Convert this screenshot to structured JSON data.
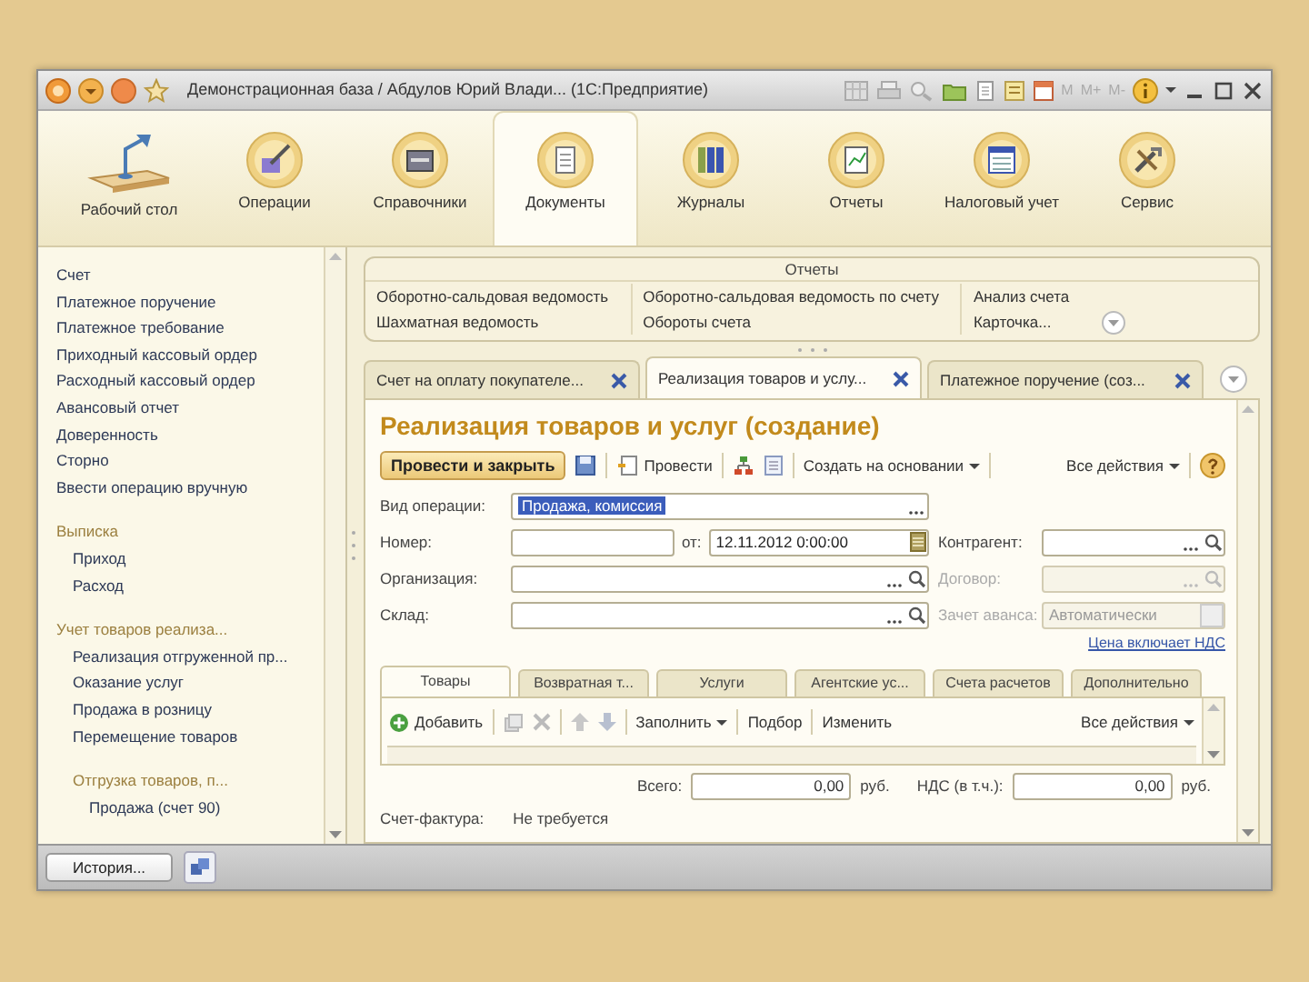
{
  "window": {
    "title": "Демонстрационная база / Абдулов Юрий Влади... (1С:Предприятие)",
    "memory_buttons": [
      "M",
      "M+",
      "M-"
    ]
  },
  "sections": [
    {
      "label": "Рабочий стол",
      "selected": false
    },
    {
      "label": "Операции",
      "selected": false
    },
    {
      "label": "Справочники",
      "selected": false
    },
    {
      "label": "Документы",
      "selected": true
    },
    {
      "label": "Журналы",
      "selected": false
    },
    {
      "label": "Отчеты",
      "selected": false
    },
    {
      "label": "Налоговый учет",
      "selected": false
    },
    {
      "label": "Сервис",
      "selected": false
    }
  ],
  "navigation": [
    {
      "kind": "item",
      "label": "Счет"
    },
    {
      "kind": "item",
      "label": "Платежное поручение"
    },
    {
      "kind": "item",
      "label": "Платежное требование"
    },
    {
      "kind": "item",
      "label": "Приходный кассовый ордер"
    },
    {
      "kind": "item",
      "label": "Расходный кассовый ордер"
    },
    {
      "kind": "item",
      "label": "Авансовый отчет"
    },
    {
      "kind": "item",
      "label": "Доверенность"
    },
    {
      "kind": "item",
      "label": "Сторно"
    },
    {
      "kind": "item",
      "label": "Ввести операцию вручную"
    },
    {
      "kind": "group",
      "label": "Выписка",
      "children": [
        {
          "kind": "item",
          "label": "Приход"
        },
        {
          "kind": "item",
          "label": "Расход"
        }
      ]
    },
    {
      "kind": "group",
      "label": "Учет товаров реализа...",
      "children": [
        {
          "kind": "item",
          "label": "Реализация отгруженной пр..."
        },
        {
          "kind": "item",
          "label": "Оказание услуг"
        },
        {
          "kind": "item",
          "label": "Продажа в розницу"
        },
        {
          "kind": "item",
          "label": "Перемещение товаров"
        },
        {
          "kind": "group",
          "label": "Отгрузка товаров, п...",
          "children": [
            {
              "kind": "item",
              "label": "Продажа (счет 90)"
            }
          ]
        }
      ]
    }
  ],
  "reports": {
    "title": "Отчеты",
    "columns": [
      [
        "Оборотно-сальдовая ведомость",
        "Шахматная ведомость"
      ],
      [
        "Оборотно-сальдовая ведомость по счету",
        "Обороты счета"
      ],
      [
        "Анализ счета",
        "Карточка..."
      ]
    ]
  },
  "open_tabs": [
    {
      "label": "Счет на оплату покупателе...",
      "selected": false
    },
    {
      "label": "Реализация товаров и услу...",
      "selected": true
    },
    {
      "label": "Платежное поручение (соз...",
      "selected": false
    }
  ],
  "document": {
    "title": "Реализация товаров и услуг (создание)",
    "toolbar": {
      "post_close": "Провести и закрыть",
      "post": "Провести",
      "create_based": "Создать на основании",
      "all_actions": "Все действия"
    },
    "field_rows": [
      [
        {
          "label": "Вид операции:",
          "value": "Продажа, комиссия",
          "kind": "select",
          "highlighted": true,
          "disabled": false
        }
      ],
      [
        {
          "label": "Номер:",
          "kind": "text",
          "disabled": false
        },
        {
          "label": "от:",
          "value": "12.11.2012  0:00:00",
          "kind": "date",
          "disabled": false
        },
        {
          "label": "Контрагент:",
          "kind": "lookup",
          "disabled": false
        }
      ],
      [
        {
          "label": "Организация:",
          "kind": "lookup",
          "disabled": false
        },
        {
          "label": "Договор:",
          "kind": "lookup",
          "disabled": true
        }
      ],
      [
        {
          "label": "Склад:",
          "kind": "lookup",
          "disabled": false
        },
        {
          "label": "Зачет аванса:",
          "value": "Автоматически",
          "kind": "list",
          "disabled": true
        }
      ]
    ],
    "price_link": "Цена включает НДС",
    "inner_tabs": [
      {
        "label": "Товары",
        "selected": true
      },
      {
        "label": "Возвратная т...",
        "selected": false
      },
      {
        "label": "Услуги",
        "selected": false
      },
      {
        "label": "Агентские ус...",
        "selected": false
      },
      {
        "label": "Счета расчетов",
        "selected": false
      },
      {
        "label": "Дополнительно",
        "selected": false
      }
    ],
    "table_toolbar": {
      "add": "Добавить",
      "fill": "Заполнить",
      "pick": "Подбор",
      "edit": "Изменить",
      "all_actions": "Все действия"
    },
    "totals": [
      {
        "label": "Всего:",
        "value": "0,00",
        "unit": "руб."
      },
      {
        "label": "НДС (в т.ч.):",
        "value": "0,00",
        "unit": "руб."
      }
    ],
    "invoice": {
      "label": "Счет-фактура:",
      "value": "Не требуется"
    }
  },
  "history_button": "История..."
}
